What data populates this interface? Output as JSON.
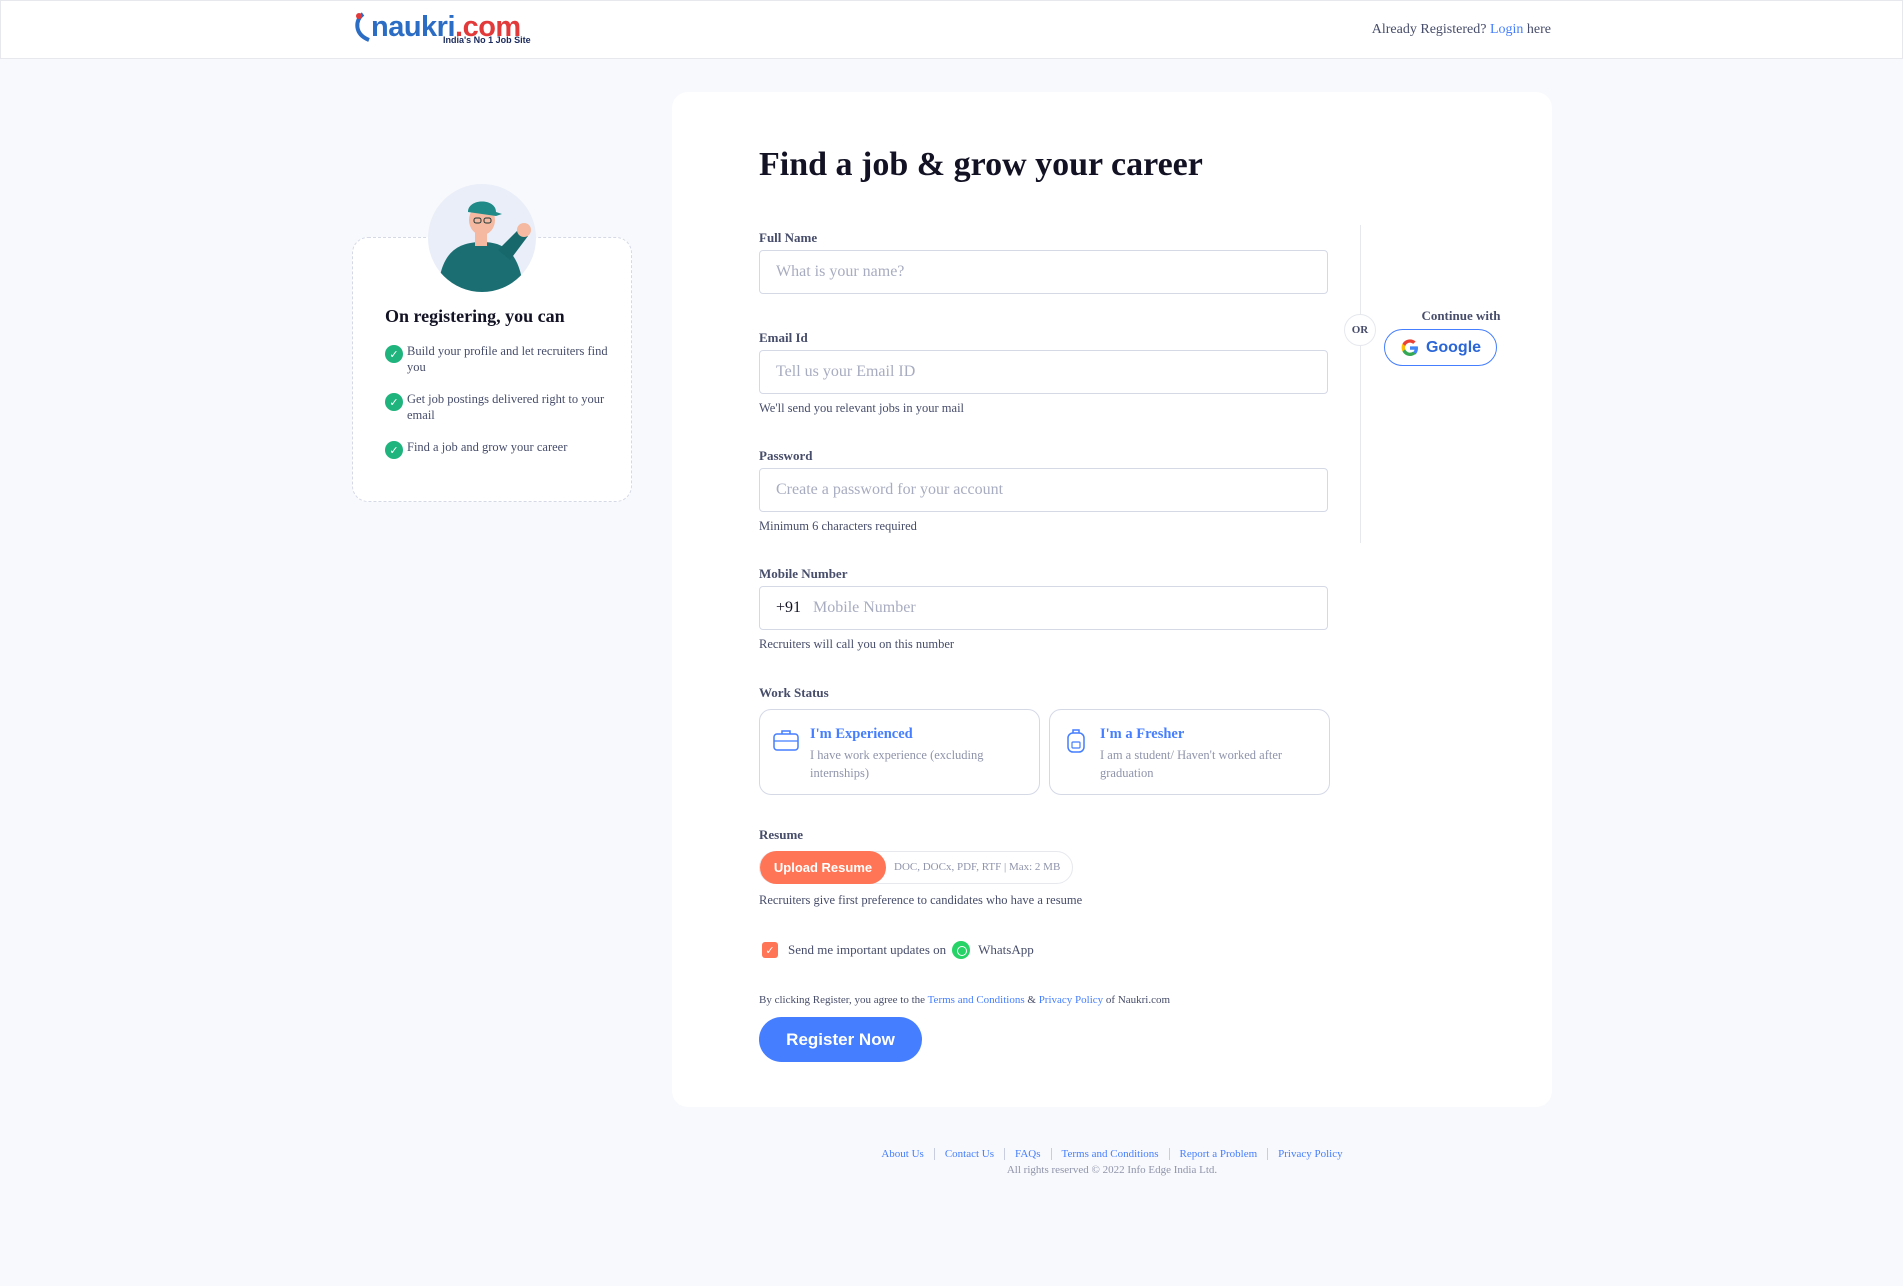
{
  "header": {
    "logo_text": "naukri",
    "logo_suffix": ".com",
    "logo_tagline": "India's No 1 Job Site",
    "already_registered": "Already Registered?",
    "login_link": "Login",
    "login_suffix": "here"
  },
  "benefits": {
    "title": "On registering, you can",
    "items": [
      "Build your profile and let recruiters find you",
      "Get job postings delivered right to your email",
      "Find a job and grow your career"
    ]
  },
  "form": {
    "heading": "Find a job & grow your career",
    "full_name": {
      "label": "Full Name",
      "placeholder": "What is your name?"
    },
    "email": {
      "label": "Email Id",
      "placeholder": "Tell us your Email ID",
      "hint": "We'll send you relevant jobs in your mail"
    },
    "password": {
      "label": "Password",
      "placeholder": "Create a password for your account",
      "hint": "Minimum 6 characters required"
    },
    "mobile": {
      "label": "Mobile Number",
      "code": "+91",
      "placeholder": "Mobile Number",
      "hint": "Recruiters will call you on this number"
    },
    "work_status": {
      "label": "Work Status",
      "experienced": {
        "title": "I'm Experienced",
        "sub": "I have work experience (excluding internships)"
      },
      "fresher": {
        "title": "I'm a Fresher",
        "sub": "I am a student/ Haven't worked after graduation"
      }
    },
    "resume": {
      "label": "Resume",
      "button": "Upload Resume",
      "formats": "DOC, DOCx, PDF, RTF | Max: 2 MB",
      "hint": "Recruiters give first preference to candidates who have a resume"
    },
    "whatsapp": {
      "text": "Send me important updates on",
      "app": "WhatsApp",
      "checked": true
    },
    "terms": {
      "prefix": "By clicking Register, you agree to the",
      "terms_link": "Terms and Conditions",
      "amp": "&",
      "privacy_link": "Privacy Policy",
      "suffix": "of Naukri.com"
    },
    "register_button": "Register Now"
  },
  "social": {
    "or": "OR",
    "continue_with": "Continue with",
    "google": "Google"
  },
  "footer": {
    "links": [
      "About Us",
      "Contact Us",
      "FAQs",
      "Terms and Conditions",
      "Report a Problem",
      "Privacy Policy"
    ],
    "copyright": "All rights reserved © 2022 Info Edge India Ltd."
  },
  "colors": {
    "accent": "#457eff",
    "upload": "#ff7555",
    "check": "#1fb37e"
  }
}
